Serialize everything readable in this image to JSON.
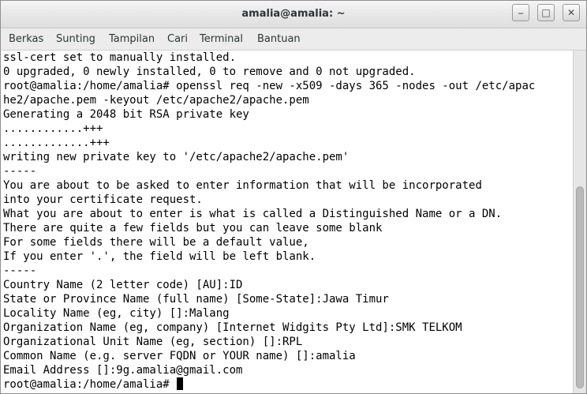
{
  "window": {
    "title": "amalia@amalia: ~",
    "buttons": {
      "minimize": "⎯",
      "maximize": "□",
      "close": "✕"
    }
  },
  "menu": {
    "items": [
      "Berkas",
      "Sunting",
      "Tampilan",
      "Cari",
      "Terminal",
      "Bantuan"
    ]
  },
  "terminal": {
    "lines": [
      "ssl-cert set to manually installed.",
      "0 upgraded, 0 newly installed, 0 to remove and 0 not upgraded.",
      "root@amalia:/home/amalia# openssl req -new -x509 -days 365 -nodes -out /etc/apac",
      "he2/apache.pem -keyout /etc/apache2/apache.pem",
      "Generating a 2048 bit RSA private key",
      "............+++",
      ".............+++",
      "writing new private key to '/etc/apache2/apache.pem'",
      "-----",
      "You are about to be asked to enter information that will be incorporated",
      "into your certificate request.",
      "What you are about to enter is what is called a Distinguished Name or a DN.",
      "There are quite a few fields but you can leave some blank",
      "For some fields there will be a default value,",
      "If you enter '.', the field will be left blank.",
      "-----",
      "Country Name (2 letter code) [AU]:ID",
      "State or Province Name (full name) [Some-State]:Jawa Timur",
      "Locality Name (eg, city) []:Malang",
      "Organization Name (eg, company) [Internet Widgits Pty Ltd]:SMK TELKOM",
      "Organizational Unit Name (eg, section) []:RPL",
      "Common Name (e.g. server FQDN or YOUR name) []:amalia",
      "Email Address []:9g.amalia@gmail.com"
    ],
    "prompt": "root@amalia:/home/amalia# "
  }
}
